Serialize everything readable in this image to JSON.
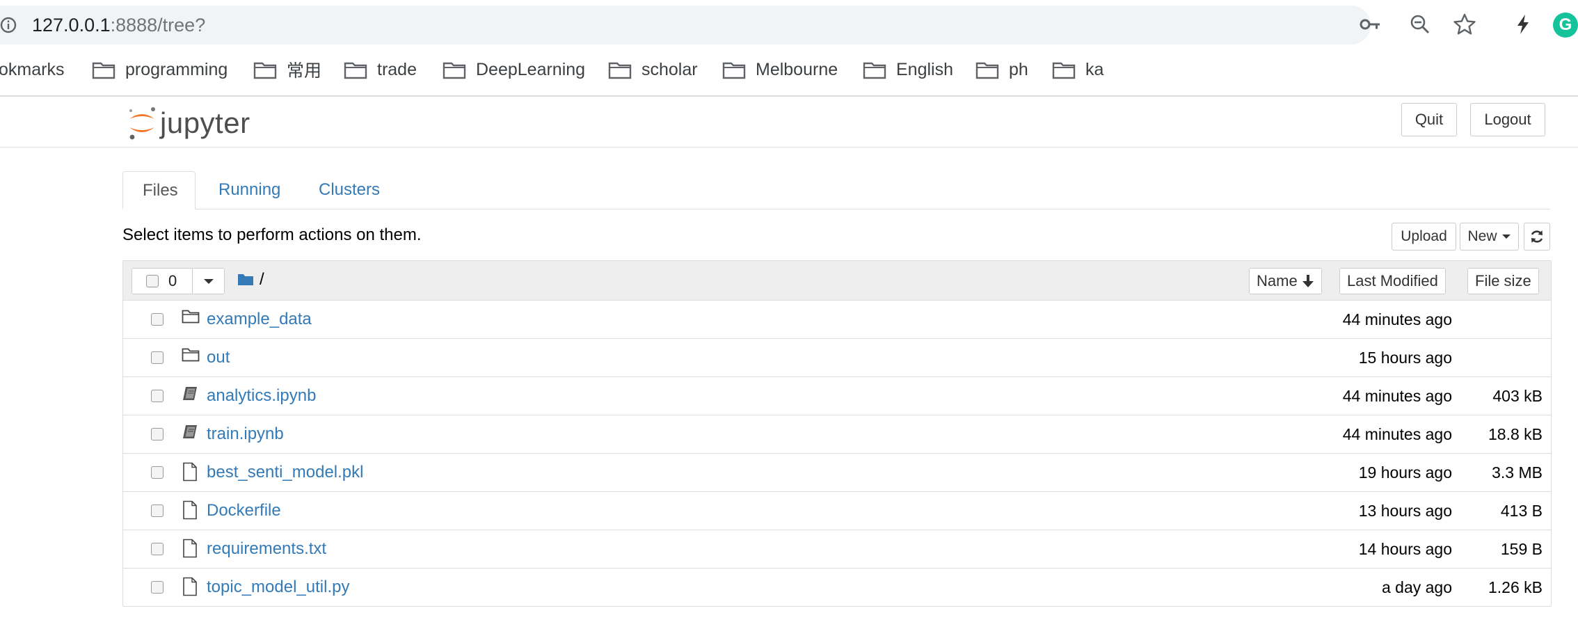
{
  "browser": {
    "url_host": "127.0.0.1",
    "url_rest": ":8888/tree?",
    "bookmarks": [
      "okmarks",
      "programming",
      "常用",
      "trade",
      "DeepLearning",
      "scholar",
      "Melbourne",
      "English",
      "ph",
      "ka"
    ],
    "extension_letter": "G"
  },
  "header": {
    "logo_text": "jupyter",
    "quit_label": "Quit",
    "logout_label": "Logout"
  },
  "tabs": [
    {
      "label": "Files",
      "active": true
    },
    {
      "label": "Running",
      "active": false
    },
    {
      "label": "Clusters",
      "active": false
    }
  ],
  "toolbar": {
    "hint": "Select items to perform actions on them.",
    "upload_label": "Upload",
    "new_label": "New"
  },
  "list_header": {
    "selected_count": "0",
    "breadcrumb": "/",
    "name_label": "Name",
    "modified_label": "Last Modified",
    "size_label": "File size"
  },
  "files": [
    {
      "name": "example_data",
      "type": "folder",
      "modified": "44 minutes ago",
      "size": ""
    },
    {
      "name": "out",
      "type": "folder",
      "modified": "15 hours ago",
      "size": ""
    },
    {
      "name": "analytics.ipynb",
      "type": "notebook",
      "modified": "44 minutes ago",
      "size": "403 kB"
    },
    {
      "name": "train.ipynb",
      "type": "notebook",
      "modified": "44 minutes ago",
      "size": "18.8 kB"
    },
    {
      "name": "best_senti_model.pkl",
      "type": "file",
      "modified": "19 hours ago",
      "size": "3.3 MB"
    },
    {
      "name": "Dockerfile",
      "type": "file",
      "modified": "13 hours ago",
      "size": "413 B"
    },
    {
      "name": "requirements.txt",
      "type": "file",
      "modified": "14 hours ago",
      "size": "159 B"
    },
    {
      "name": "topic_model_util.py",
      "type": "file",
      "modified": "a day ago",
      "size": "1.26 kB"
    }
  ],
  "colors": {
    "link": "#337ab7",
    "jupyter_orange": "#f37726",
    "grammarly": "#15c39a"
  }
}
